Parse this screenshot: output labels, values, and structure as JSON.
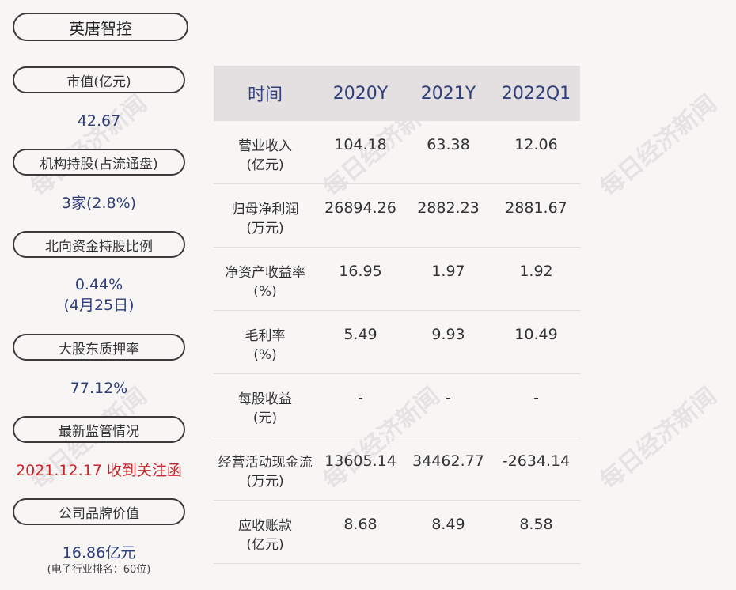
{
  "company": {
    "name": "英唐智控"
  },
  "sidebar": {
    "market_cap": {
      "label": "市值(亿元)",
      "value": "42.67"
    },
    "institutional": {
      "label": "机构持股(占流通盘)",
      "value": "3家(2.8%)"
    },
    "northbound": {
      "label": "北向资金持股比例",
      "value": "0.44%",
      "date": "(4月25日)"
    },
    "pledge": {
      "label": "大股东质押率",
      "value": "77.12%"
    },
    "regulation": {
      "label": "最新监管情况",
      "value": "2021.12.17 收到关注函"
    },
    "brand": {
      "label": "公司品牌价值",
      "value": "16.86亿元",
      "note": "(电子行业排名：60位)"
    }
  },
  "table": {
    "headers": [
      "时间",
      "2020Y",
      "2021Y",
      "2022Q1"
    ],
    "rows": [
      {
        "label": [
          "营业收入",
          "(亿元)"
        ],
        "values": [
          "104.18",
          "63.38",
          "12.06"
        ]
      },
      {
        "label": [
          "归母净利润",
          "(万元)"
        ],
        "values": [
          "26894.26",
          "2882.23",
          "2881.67"
        ]
      },
      {
        "label": [
          "净资产收益率",
          "(%)"
        ],
        "values": [
          "16.95",
          "1.97",
          "1.92"
        ]
      },
      {
        "label": [
          "毛利率",
          "(%)"
        ],
        "values": [
          "5.49",
          "9.93",
          "10.49"
        ]
      },
      {
        "label": [
          "每股收益",
          "(元)"
        ],
        "values": [
          "-",
          "-",
          "-"
        ]
      },
      {
        "label": [
          "经营活动现金流",
          "(万元)"
        ],
        "values": [
          "13605.14",
          "34462.77",
          "-2634.14"
        ]
      },
      {
        "label": [
          "应收账款",
          "(亿元)"
        ],
        "values": [
          "8.68",
          "8.49",
          "8.58"
        ]
      }
    ]
  },
  "watermark": "每日经济新闻",
  "colors": {
    "value_blue": "#2f3f7a",
    "alert_red": "#c8252a",
    "header_bg": "#e4dfe0"
  }
}
